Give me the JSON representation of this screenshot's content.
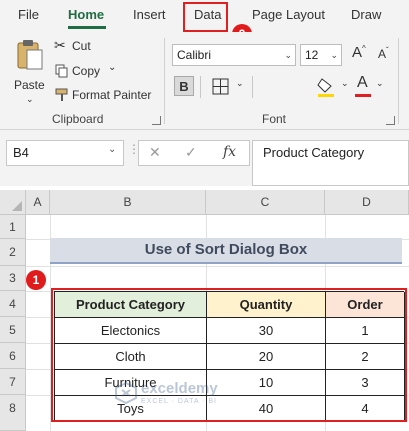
{
  "ribbon_tabs": [
    "File",
    "Home",
    "Insert",
    "Data",
    "Page Layout",
    "Draw"
  ],
  "badges": {
    "data_tab": "2",
    "table": "1"
  },
  "clipboard": {
    "paste": "Paste",
    "cut": "Cut",
    "copy": "Copy",
    "format_painter": "Format Painter",
    "group_label": "Clipboard"
  },
  "font": {
    "name": "Calibri",
    "size": "12",
    "bold": "B",
    "group_label": "Font"
  },
  "formula_bar": {
    "name_box": "B4",
    "fx": "fx",
    "content": "Product Category"
  },
  "sheet": {
    "columns": [
      "A",
      "B",
      "C",
      "D"
    ],
    "rows": [
      "1",
      "2",
      "3",
      "4",
      "5",
      "6",
      "7",
      "8"
    ],
    "title": "Use of Sort Dialog Box",
    "table": {
      "headers": [
        "Product Category",
        "Quantity",
        "Order"
      ],
      "rows": [
        [
          "Electonics",
          "30",
          "1"
        ],
        [
          "Cloth",
          "20",
          "2"
        ],
        [
          "Furniture",
          "10",
          "3"
        ],
        [
          "Toys",
          "40",
          "4"
        ]
      ]
    }
  },
  "watermark": {
    "name": "exceldemy",
    "sub": "EXCEL · DATA · BI"
  },
  "colors": {
    "accent": "#1f6e43",
    "highlight": "#e02020",
    "header_green": "#e2efda",
    "header_yellow": "#fff2cc",
    "header_peach": "#fce4d6",
    "title_fill": "#d8dde6"
  }
}
